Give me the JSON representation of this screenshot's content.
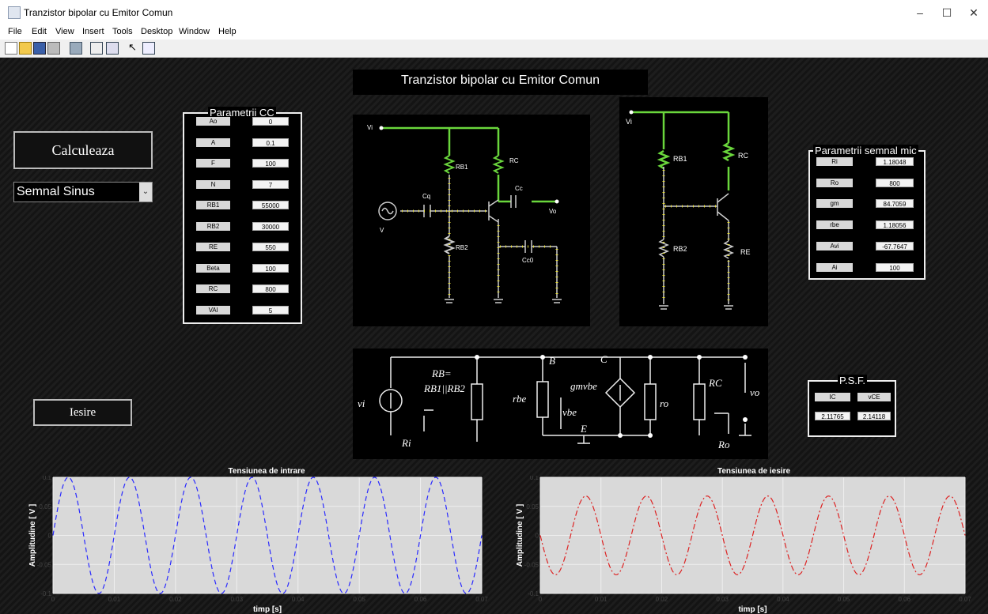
{
  "window": {
    "title": "Tranzistor bipolar cu Emitor Comun",
    "min": "–",
    "max": "☐",
    "close": "✕"
  },
  "menu": [
    "File",
    "Edit",
    "View",
    "Insert",
    "Tools",
    "Desktop",
    "Window",
    "Help"
  ],
  "toolbar_icons": [
    "new-icon",
    "open-icon",
    "save-icon",
    "print-icon",
    "link-icon",
    "panel-icon",
    "grid-icon",
    "pointer-icon",
    "inspector-icon"
  ],
  "main_title": "Tranzistor bipolar cu Emitor Comun",
  "calculate_button": "Calculeaza",
  "signal_select": {
    "value": "Semnal Sinus"
  },
  "output_button": "Iesire",
  "cc_panel": {
    "title": "Parametrii CC",
    "rows": [
      {
        "label": "Ao",
        "value": "0"
      },
      {
        "label": "A",
        "value": "0.1"
      },
      {
        "label": "F",
        "value": "100"
      },
      {
        "label": "N",
        "value": "7"
      },
      {
        "label": "RB1",
        "value": "55000"
      },
      {
        "label": "RB2",
        "value": "30000"
      },
      {
        "label": "RE",
        "value": "550"
      },
      {
        "label": "Beta",
        "value": "100"
      },
      {
        "label": "RC",
        "value": "800"
      },
      {
        "label": "VAl",
        "value": "5"
      }
    ]
  },
  "small_signal_panel": {
    "title": "Parametrii semnal mic",
    "rows": [
      {
        "label": "Ri",
        "value": "1.18048"
      },
      {
        "label": "Ro",
        "value": "800"
      },
      {
        "label": "gm",
        "value": "84.7059"
      },
      {
        "label": "rbe",
        "value": "1.18056"
      },
      {
        "label": "Avi",
        "value": "-67.7647"
      },
      {
        "label": "Ai",
        "value": "100"
      }
    ]
  },
  "psf_panel": {
    "title": "P.S.F.",
    "labels": [
      "IC",
      "vCE"
    ],
    "values": [
      "2.11765",
      "2.14118"
    ]
  },
  "circuit1_labels": {
    "vi": "Vi",
    "rb1": "RB1",
    "rc": "RC",
    "cq": "Cq",
    "cc": "Cc",
    "vo": "Vo",
    "v": "V",
    "rb2": "RB2",
    "cc0": "Cc0"
  },
  "circuit2_labels": {
    "vi": "Vi",
    "rb1": "RB1",
    "rc": "RC",
    "rb2": "RB2",
    "re": "RE"
  },
  "smallsig_labels": {
    "vi": "vi",
    "ri": "Ri",
    "rb_eq": "RB=",
    "rb_par": "RB1||RB2",
    "b": "B",
    "c": "C",
    "e": "E",
    "rbe": "rbe",
    "vbe": "vbe",
    "gm": "gmvbe",
    "ro": "ro",
    "rc": "RC",
    "vo": "vo",
    "ro_out": "Ro"
  },
  "chart_data": [
    {
      "type": "line",
      "title": "Tensiunea de intrare",
      "xlabel": "timp [s]",
      "ylabel": "Amplitudine [ V ]",
      "xlim": [
        0,
        0.07
      ],
      "ylim": [
        -0.1,
        0.1
      ],
      "xticks": [
        "0",
        "0.01",
        "0.02",
        "0.03",
        "0.04",
        "0.05",
        "0.06",
        "0.07"
      ],
      "yticks": [
        "0.1",
        "0.05",
        "0",
        "-0.05",
        "-0.1"
      ],
      "series": [
        {
          "function": "0.1*sin(2*pi*100*t)",
          "amplitude": 0.1,
          "frequency": 100,
          "color": "#2a2aff",
          "style": "dashed"
        }
      ]
    },
    {
      "type": "line",
      "title": "Tensiunea de iesire",
      "xlabel": "timp [s]",
      "ylabel": "Amplitudine [ V ]",
      "xlim": [
        0,
        0.07
      ],
      "ylim": [
        -0.1,
        0.1
      ],
      "xticks": [
        "0",
        "0.01",
        "0.02",
        "0.03",
        "0.04",
        "0.05",
        "0.06",
        "0.07"
      ],
      "yticks": [
        "0.1",
        "0.05",
        "0",
        "-0.05",
        "-0.1"
      ],
      "series": [
        {
          "function": "-0.0677647*sin(2*pi*100*t)",
          "amplitude": 0.0677647,
          "frequency": 100,
          "phase": "inverted",
          "color": "#dd2222",
          "style": "dashdot"
        }
      ]
    }
  ]
}
